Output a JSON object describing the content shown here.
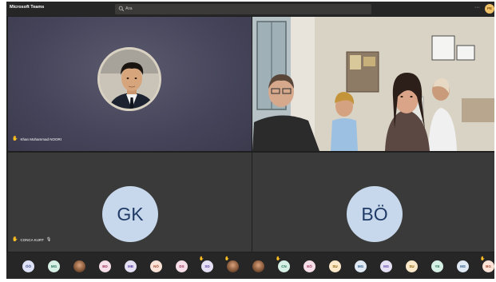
{
  "titlebar": {
    "app_title": "Microsoft Teams",
    "search_placeholder": "Ara",
    "me_initials": "PE"
  },
  "tiles": {
    "tile1_name": "Khan Mohammad NOORI",
    "tile3_initials": "GK",
    "tile3_name": "CONCA KURT",
    "tile4_initials": "BÖ"
  },
  "participants": [
    {
      "initials": "ÖÖ",
      "bg": "#dfe3f7",
      "fg": "#3b4a8a"
    },
    {
      "initials": "MG",
      "bg": "#d7f0e6",
      "fg": "#22715a"
    },
    {
      "initials": "",
      "photo": true
    },
    {
      "initials": "BD",
      "bg": "#f6dfe8",
      "fg": "#9c2d5a"
    },
    {
      "initials": "MB",
      "bg": "#e5e0f4",
      "fg": "#5b3fa6"
    },
    {
      "initials": "NÖ",
      "bg": "#fbe3d8",
      "fg": "#a2472a"
    },
    {
      "initials": "DS",
      "bg": "#f6dfe8",
      "fg": "#9c2d5a"
    },
    {
      "initials": "SD",
      "bg": "#e5e0f4",
      "fg": "#5b3fa6",
      "hand": true
    },
    {
      "initials": "",
      "photo": true,
      "hand": true
    },
    {
      "initials": "",
      "photo": true
    },
    {
      "initials": "CN",
      "bg": "#d7f0e6",
      "fg": "#22715a",
      "hand": true
    },
    {
      "initials": "EÖ",
      "bg": "#f6dfe8",
      "fg": "#9c2d5a"
    },
    {
      "initials": "SU",
      "bg": "#fbe9c9",
      "fg": "#8a5a00"
    },
    {
      "initials": "MG",
      "bg": "#e0eaf4",
      "fg": "#2d5a86"
    },
    {
      "initials": "MS",
      "bg": "#e5e0f4",
      "fg": "#5b3fa6"
    },
    {
      "initials": "SU",
      "bg": "#fbe9c9",
      "fg": "#8a5a00"
    },
    {
      "initials": "YE",
      "bg": "#d7f0e6",
      "fg": "#22715a"
    },
    {
      "initials": "MS",
      "bg": "#e0eaf4",
      "fg": "#2d5a86"
    },
    {
      "initials": "BG",
      "bg": "#fbe3d8",
      "fg": "#a2472a",
      "hand": true
    }
  ]
}
